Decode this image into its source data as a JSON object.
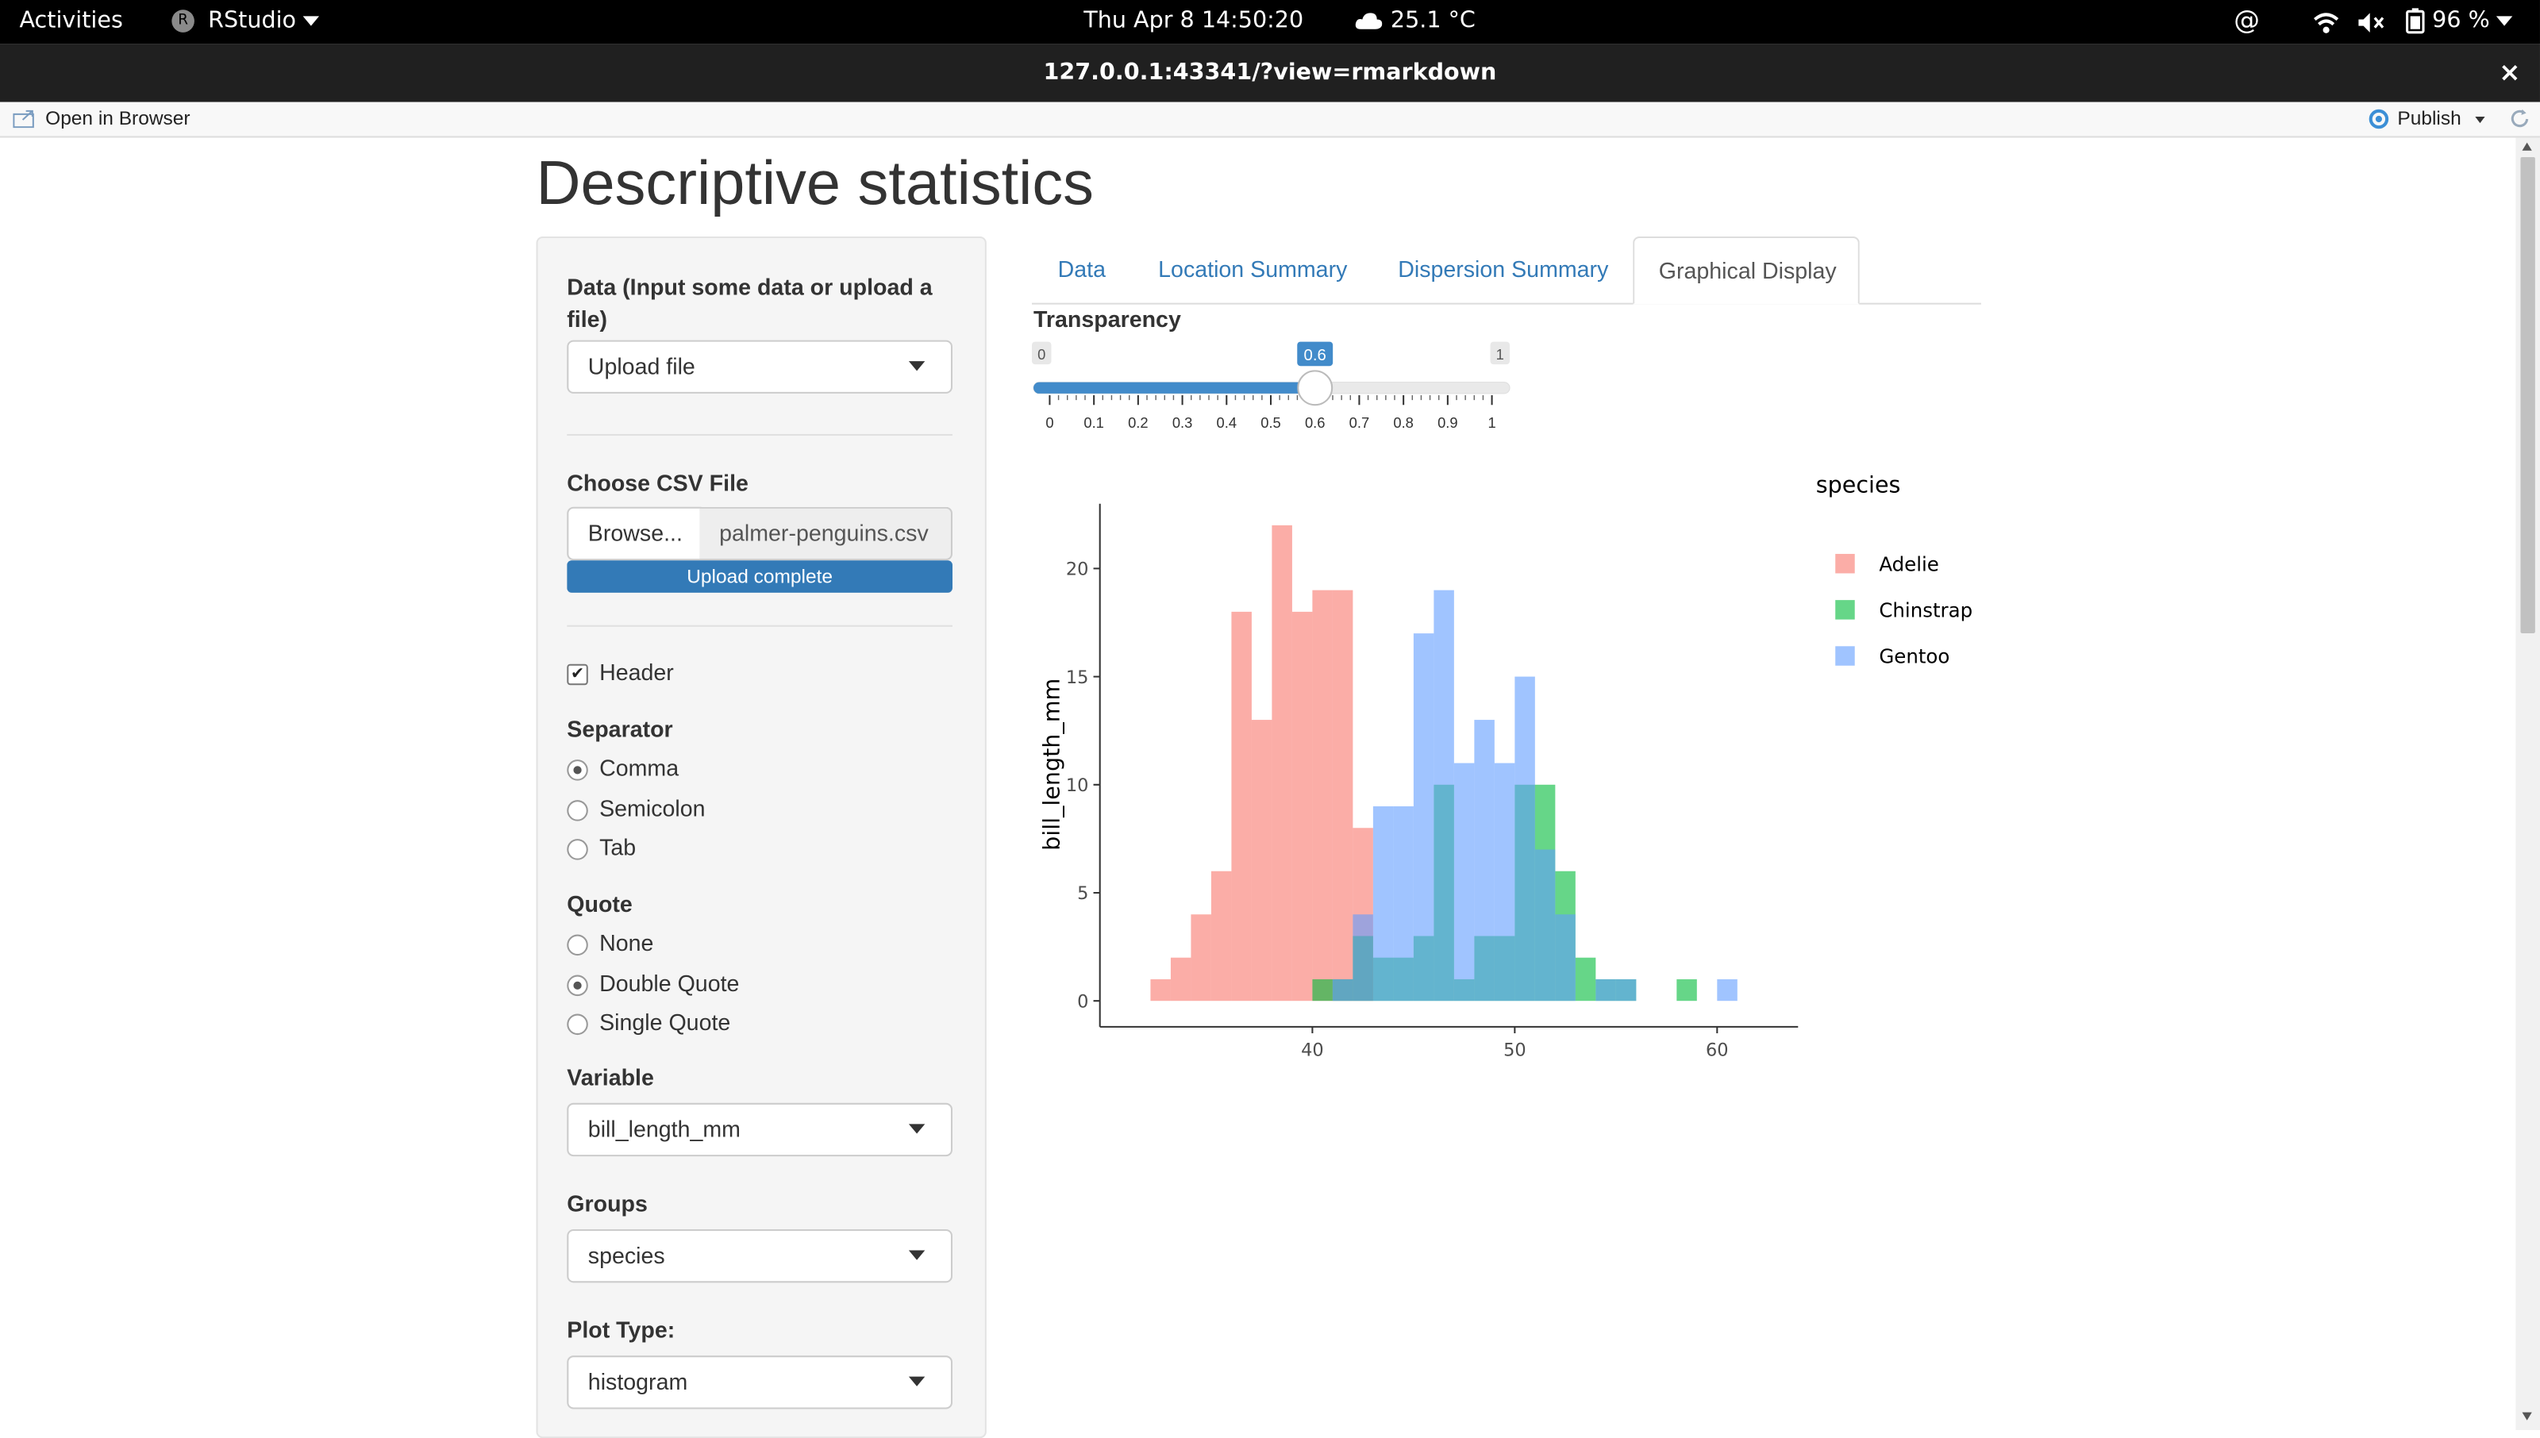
{
  "system_bar": {
    "activities": "Activities",
    "app_name": "RStudio",
    "datetime": "Thu Apr 8  14:50:20",
    "weather": "25.1 °C",
    "battery": "96 %"
  },
  "window": {
    "url": "127.0.0.1:43341/?view=rmarkdown",
    "close_glyph": "×"
  },
  "toolbar": {
    "open_in_browser": "Open in Browser",
    "publish": "Publish"
  },
  "page": {
    "title": "Descriptive statistics"
  },
  "sidebar": {
    "data_label": "Data (Input some data or upload a file)",
    "data_value": "Upload file",
    "csv_label": "Choose CSV File",
    "browse_label": "Browse...",
    "file_name": "palmer-penguins.csv",
    "upload_status": "Upload complete",
    "upload_progress": 1.0,
    "header_label": "Header",
    "header_checked": true,
    "separator_label": "Separator",
    "separator_options": [
      "Comma",
      "Semicolon",
      "Tab"
    ],
    "separator_selected": "Comma",
    "quote_label": "Quote",
    "quote_options": [
      "None",
      "Double Quote",
      "Single Quote"
    ],
    "quote_selected": "Double Quote",
    "variable_label": "Variable",
    "variable_value": "bill_length_mm",
    "groups_label": "Groups",
    "groups_value": "species",
    "plot_type_label": "Plot Type:",
    "plot_type_value": "histogram"
  },
  "tabs": [
    {
      "label": "Data",
      "active": false
    },
    {
      "label": "Location Summary",
      "active": false
    },
    {
      "label": "Dispersion Summary",
      "active": false
    },
    {
      "label": "Graphical Display",
      "active": true
    }
  ],
  "transparency": {
    "label": "Transparency",
    "min": "0",
    "max": "1",
    "value": 0.6,
    "value_label": "0.6",
    "ticks": [
      "0",
      "0.1",
      "0.2",
      "0.3",
      "0.4",
      "0.5",
      "0.6",
      "0.7",
      "0.8",
      "0.9",
      "1"
    ]
  },
  "colors": {
    "accent": "#337ab7",
    "adelie": "#F8766D",
    "chinstrap": "#00BA38",
    "gentoo": "#619CFF"
  },
  "chart_data": {
    "type": "histogram",
    "xlabel": "",
    "ylabel": "bill_length_mm",
    "legend_title": "species",
    "legend_position": "right",
    "xlim": [
      29.5,
      64
    ],
    "ylim": [
      -1.2,
      23
    ],
    "xticks": [
      40,
      50,
      60
    ],
    "yticks": [
      0,
      5,
      10,
      15,
      20
    ],
    "grid": false,
    "alpha": 0.6,
    "bin_width": 1,
    "bins_start": [
      32,
      33,
      34,
      35,
      36,
      37,
      38,
      39,
      40,
      41,
      42,
      43,
      44,
      45,
      46,
      47,
      48,
      49,
      50,
      51,
      52,
      53,
      54,
      55,
      56,
      57,
      58,
      59,
      60
    ],
    "series": [
      {
        "name": "Adelie",
        "color": "#F8766D",
        "values": [
          1,
          2,
          4,
          6,
          18,
          13,
          22,
          18,
          19,
          19,
          8,
          0,
          0,
          0,
          0,
          0,
          0,
          0,
          0,
          0,
          0,
          0,
          0,
          0,
          0,
          0,
          0,
          0,
          0
        ]
      },
      {
        "name": "Chinstrap",
        "color": "#00BA38",
        "values": [
          0,
          0,
          0,
          0,
          0,
          0,
          0,
          0,
          1,
          1,
          3,
          2,
          2,
          3,
          10,
          1,
          3,
          3,
          10,
          10,
          6,
          2,
          1,
          1,
          0,
          0,
          1,
          0,
          0
        ]
      },
      {
        "name": "Gentoo",
        "color": "#619CFF",
        "values": [
          0,
          0,
          0,
          0,
          0,
          0,
          0,
          0,
          0,
          1,
          4,
          9,
          9,
          17,
          19,
          11,
          13,
          11,
          15,
          7,
          4,
          0,
          1,
          1,
          0,
          0,
          0,
          0,
          1
        ]
      }
    ]
  }
}
